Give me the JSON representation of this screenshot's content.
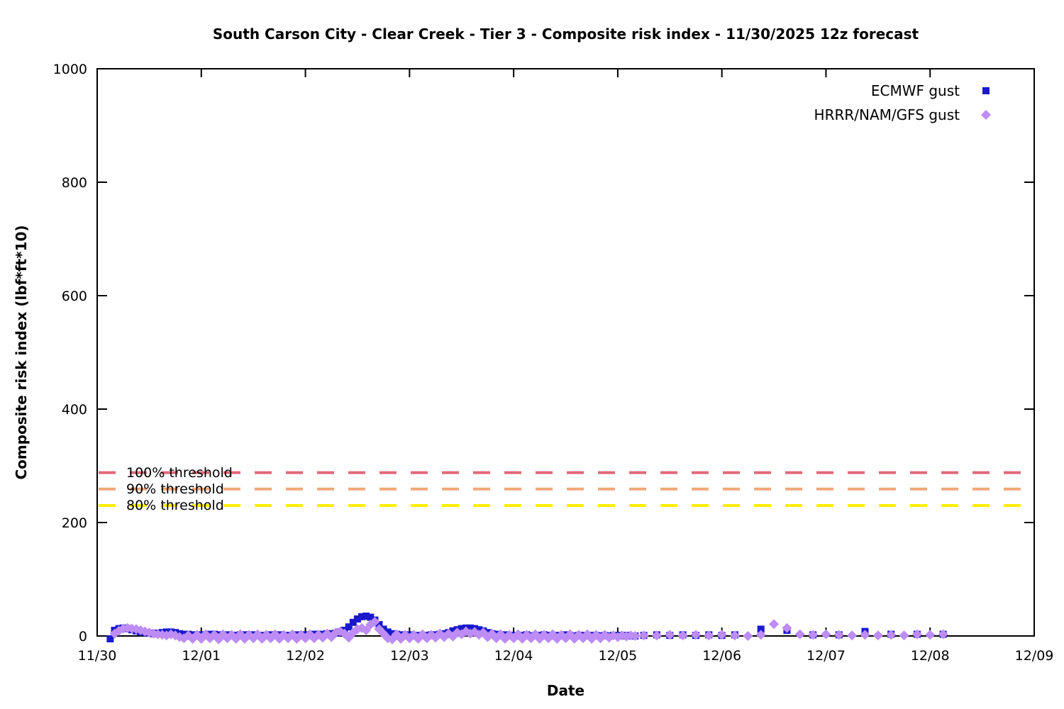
{
  "chart_data": {
    "type": "scatter",
    "title": "South Carson City - Clear Creek - Tier 3 - Composite risk index - 11/30/2025 12z forecast",
    "xlabel": "Date",
    "ylabel": "Composite risk index (lbf*ft*10)",
    "xlim": [
      0,
      9
    ],
    "ylim": [
      0,
      1000
    ],
    "x_tick_labels": [
      "11/30",
      "12/01",
      "12/02",
      "12/03",
      "12/04",
      "12/05",
      "12/06",
      "12/07",
      "12/08",
      "12/09"
    ],
    "y_ticks": [
      0,
      200,
      400,
      600,
      800,
      1000
    ],
    "grid": false,
    "legend_position": "top-right",
    "x_encoding": "days after 11/30 00z",
    "thresholds": [
      {
        "label": "100% threshold",
        "value": 288,
        "color": "#e0697a"
      },
      {
        "label": "90% threshold",
        "value": 259,
        "color": "#f2a878"
      },
      {
        "label": "80% threshold",
        "value": 230,
        "color": "#ffee00"
      }
    ],
    "legend": [
      {
        "label": "ECMWF gust",
        "marker": "square",
        "color": "#1a1acc"
      },
      {
        "label": "HRRR/NAM/GFS gust",
        "marker": "diamond",
        "color": "#bd8cf5"
      }
    ],
    "series": [
      {
        "name": "ECMWF gust",
        "marker": "square",
        "color": "#1a1acc",
        "marker_size": 10,
        "segments": [
          {
            "t0": 0.125,
            "dt": 0.0416667,
            "values": [
              -5,
              10,
              13,
              14,
              13,
              11,
              9,
              7,
              6,
              5,
              4,
              5,
              6,
              7,
              7,
              6,
              4,
              3,
              3,
              2,
              2,
              2,
              2,
              3,
              3,
              2,
              2,
              2,
              1,
              1,
              2,
              2,
              2,
              2,
              1,
              1,
              1,
              2,
              2,
              2,
              1,
              1,
              1,
              2,
              2,
              2,
              2,
              3,
              3,
              3,
              4,
              4,
              5,
              7,
              10,
              16,
              24,
              30,
              34,
              35,
              33,
              28,
              20,
              12,
              7,
              4,
              3,
              2,
              2,
              2,
              1,
              1,
              1,
              1,
              2,
              2,
              3,
              4,
              6,
              9,
              11,
              13,
              14,
              14,
              13,
              11,
              9,
              6,
              4,
              3,
              2,
              2,
              1,
              1,
              0,
              1,
              2,
              0,
              1,
              1,
              2,
              1,
              0,
              1,
              1,
              2,
              1,
              0,
              1,
              1,
              0,
              1,
              1,
              0,
              1,
              0,
              1,
              1,
              0,
              1,
              0,
              0
            ]
          },
          {
            "t0": 5.25,
            "dt": 0.125,
            "values": [
              1,
              2,
              1,
              2,
              1,
              2,
              1,
              2,
              null,
              12,
              null,
              10,
              null,
              2,
              null,
              2,
              null,
              8,
              null,
              3,
              null,
              3,
              null,
              3
            ]
          }
        ]
      },
      {
        "name": "HRRR/NAM/GFS gust",
        "marker": "diamond",
        "color": "#bd8cf5",
        "marker_size": 14,
        "segments": [
          {
            "t0": 0.1667,
            "dt": 0.0416667,
            "values": [
              4,
              9,
              13,
              14,
              13,
              12,
              10,
              8,
              6,
              4,
              3,
              2,
              1,
              3,
              1,
              -2,
              -4,
              1,
              -5,
              2,
              -5,
              3,
              -4,
              2,
              -6,
              3,
              -4,
              2,
              -5,
              3,
              -5,
              2,
              -4,
              3,
              -5,
              2,
              -4,
              3,
              -5,
              2,
              -4,
              3,
              -5,
              2,
              -4,
              3,
              -4,
              2,
              -3,
              4,
              -2,
              6,
              8,
              4,
              -3,
              6,
              12,
              14,
              10,
              20,
              25,
              12,
              4,
              -4,
              -6,
              3,
              -5,
              2,
              -4,
              2,
              -5,
              3,
              -4,
              2,
              -3,
              4,
              -2,
              4,
              -1,
              6,
              3,
              8,
              4,
              7,
              2,
              6,
              -2,
              4,
              -4,
              3,
              -5,
              2,
              -4,
              3,
              -5,
              2,
              -4,
              3,
              -5,
              2,
              -4,
              3,
              -5,
              2,
              -4,
              3,
              -5,
              2,
              -4,
              3,
              -5,
              2,
              -4,
              2,
              -3,
              1,
              -2,
              1,
              -1,
              1,
              0
            ]
          },
          {
            "t0": 5.25,
            "dt": 0.125,
            "values": [
              1,
              1,
              2,
              1,
              2,
              1,
              2,
              1,
              0,
              2,
              21,
              14,
              3,
              2,
              3,
              2,
              1,
              2,
              1,
              2,
              1,
              3,
              2,
              3
            ]
          }
        ]
      }
    ]
  }
}
